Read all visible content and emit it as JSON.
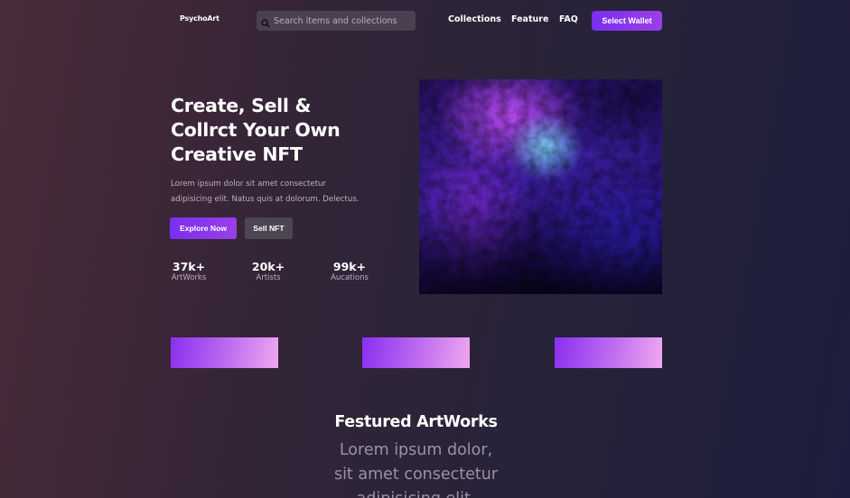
{
  "brand": {
    "logo": "PsychoArt"
  },
  "search": {
    "placeholder": "Search items and collections"
  },
  "nav": {
    "links": [
      "Collections",
      "Feature",
      "FAQ"
    ],
    "wallet_button": "Select Wallet"
  },
  "hero": {
    "title_lines": [
      "Create, Sell &",
      "Collrct Your Own",
      "Creative NFT"
    ],
    "description_lines": [
      "Lorem ipsum dolor sit amet consectetur",
      "adipisicing elit. Natus quis at dolorum. Delectus."
    ],
    "explore_button": "Explore Now",
    "sell_button": "Sell NFT",
    "stats": [
      {
        "value": "37k+",
        "label": "ArtWorks"
      },
      {
        "value": "20k+",
        "label": "Artists"
      },
      {
        "value": "99k+",
        "label": "Aucations"
      }
    ]
  },
  "featured": {
    "title": "Festured ArtWorks",
    "subtitle_lines": [
      "Lorem ipsum dolor,",
      "sit amet consectetur",
      "adipisicing elit."
    ]
  },
  "colors": {
    "accent": "#7a2ff0",
    "secondary_button": "#4d4552",
    "muted_text": "#b9b1c0"
  }
}
